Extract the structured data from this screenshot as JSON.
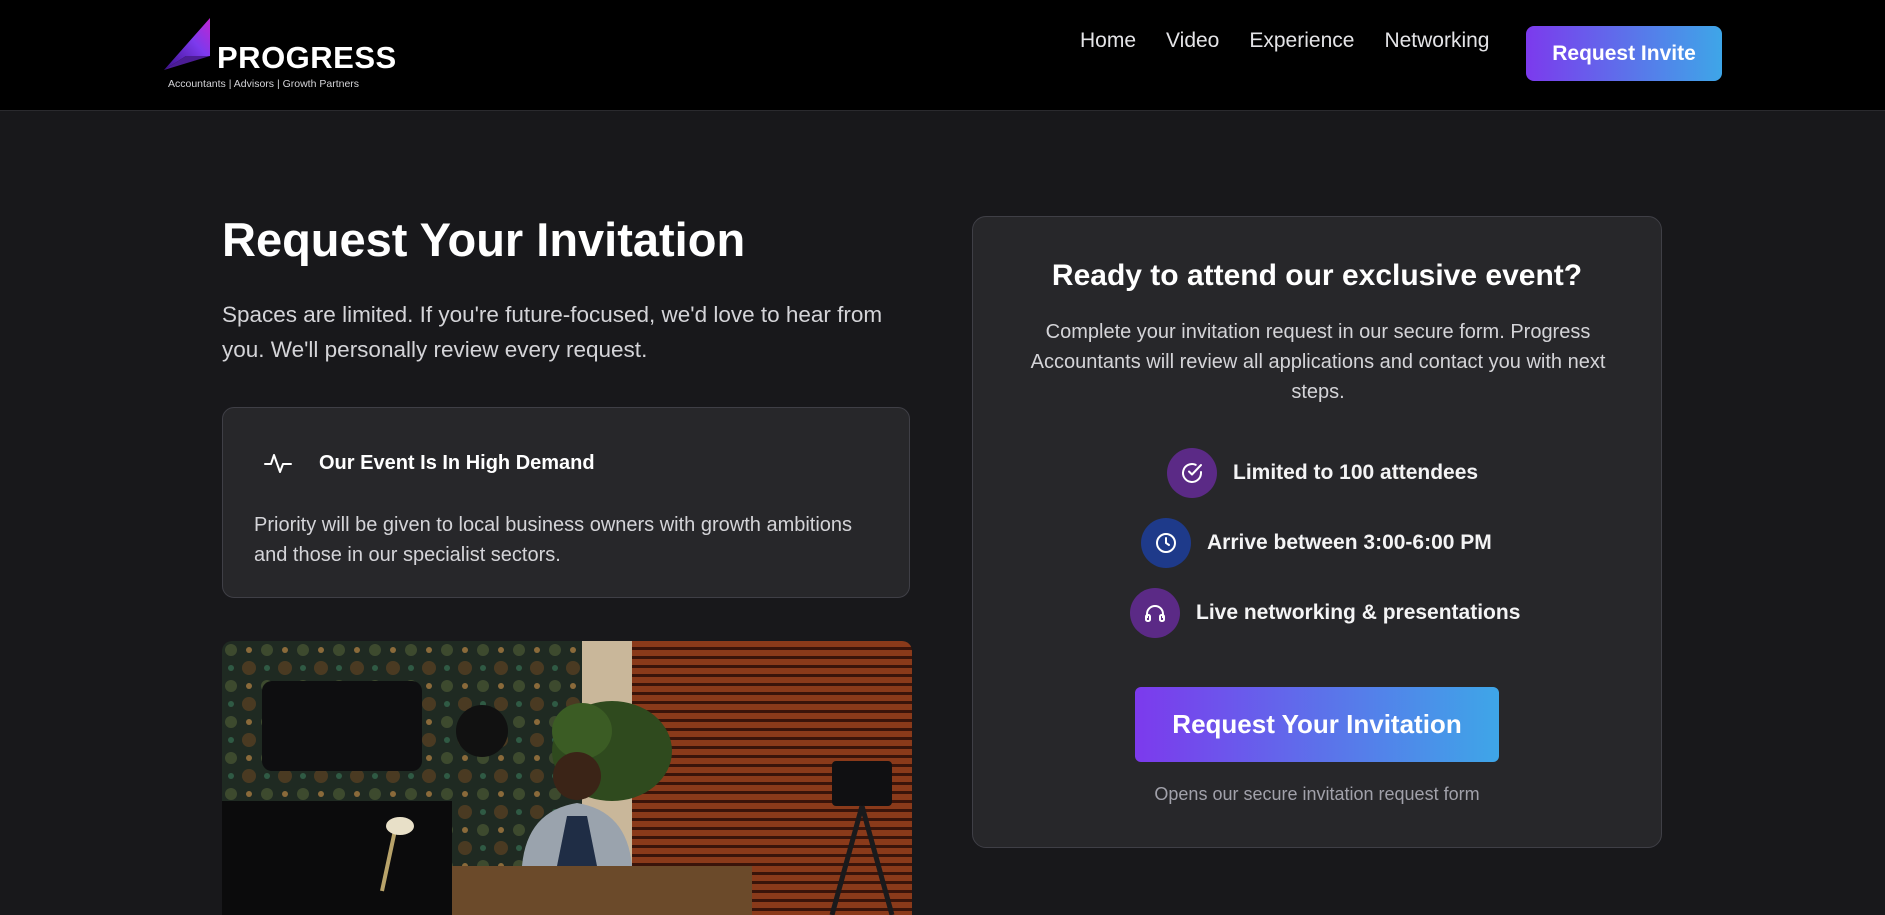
{
  "header": {
    "logo": {
      "word": "PROGRESS",
      "tagline": "Accountants | Advisors | Growth Partners"
    },
    "nav": [
      {
        "label": "Home"
      },
      {
        "label": "Video"
      },
      {
        "label": "Experience"
      },
      {
        "label": "Networking"
      }
    ],
    "cta_label": "Request Invite"
  },
  "main": {
    "title": "Request Your Invitation",
    "intro": "Spaces are limited. If you're future-focused, we'd love to hear from you. We'll personally review every request.",
    "demand_card": {
      "icon": "activity-pulse-icon",
      "title": "Our Event Is In High Demand",
      "text": "Priority will be given to local business owners with growth ambitions and those in our specialist sectors."
    },
    "photo": {
      "subject": "man seated at desk in room with camera, lamp and window blinds"
    }
  },
  "invite_card": {
    "title": "Ready to attend our exclusive event?",
    "description": "Complete your invitation request in our secure form. Progress Accountants will review all applications and contact you with next steps.",
    "features": [
      {
        "icon": "check-circle-icon",
        "text": "Limited to 100 attendees",
        "color": "#5b2a86"
      },
      {
        "icon": "clock-icon",
        "text": "Arrive between 3:00-6:00 PM",
        "color": "#1e3a8a"
      },
      {
        "icon": "headphones-icon",
        "text": "Live networking & presentations",
        "color": "#5b2a86"
      }
    ],
    "button_label": "Request Your Invitation",
    "button_note": "Opens our secure invitation request form"
  },
  "colors": {
    "background": "#18181b",
    "header": "#000000",
    "card": "#27272a",
    "gradient_start": "#7c3aed",
    "gradient_end": "#3ea6e8"
  }
}
